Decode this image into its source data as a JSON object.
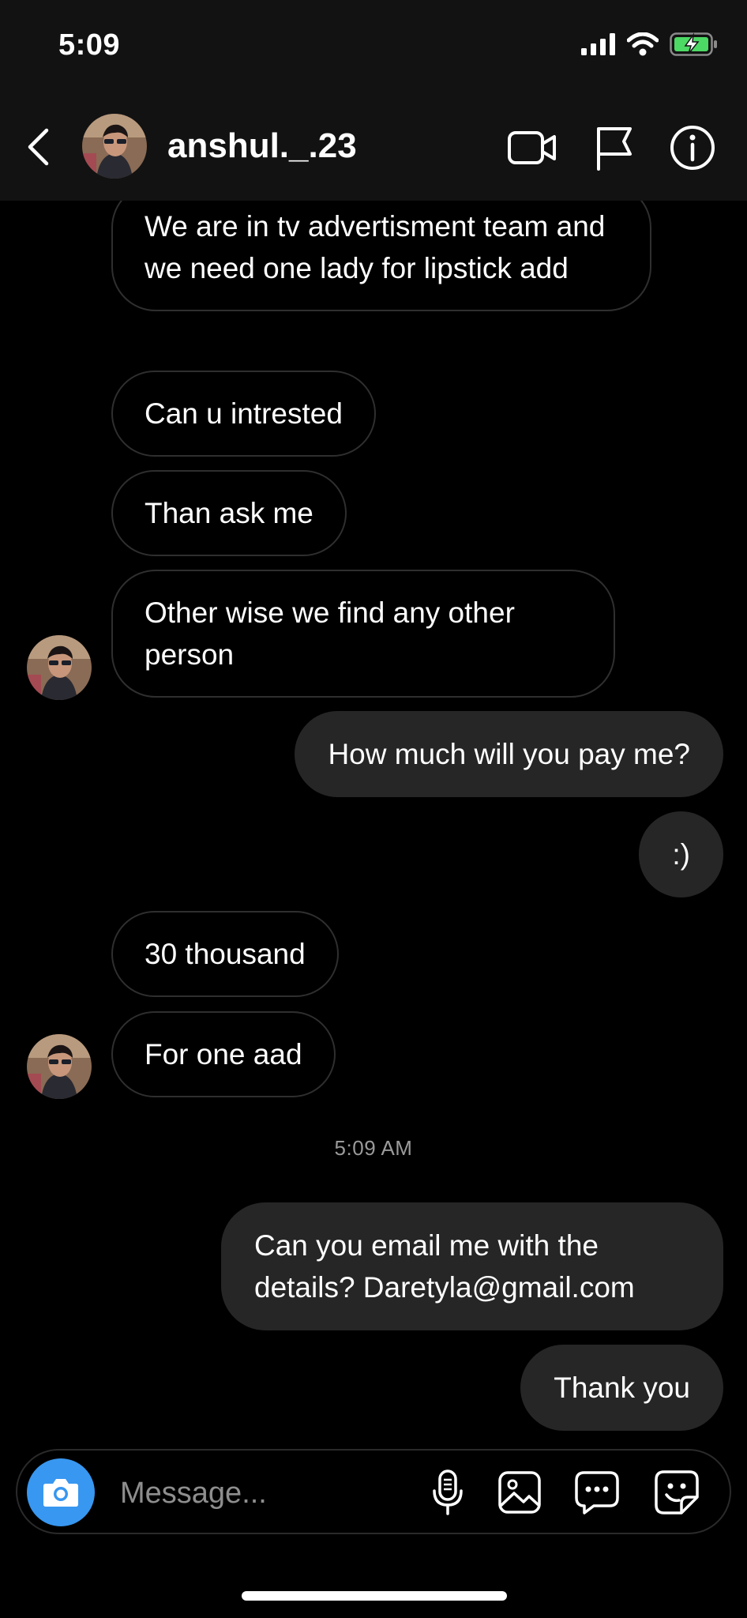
{
  "status_bar": {
    "time": "5:09"
  },
  "header": {
    "username": "anshul._.23",
    "icons": [
      "back-icon",
      "video-call-icon",
      "flag-icon",
      "info-icon"
    ]
  },
  "messages": [
    {
      "from": "them",
      "text": "We are in tv advertisment team and we need one lady for lipstick add"
    },
    {
      "from": "them",
      "text": "Can u intrested"
    },
    {
      "from": "them",
      "text": "Than ask me"
    },
    {
      "from": "them",
      "text": "Other wise we find any other person"
    },
    {
      "from": "me",
      "text": "How much will you pay me?"
    },
    {
      "from": "me",
      "text": ":)"
    },
    {
      "from": "them",
      "text": "30 thousand"
    },
    {
      "from": "them",
      "text": "For one aad"
    },
    {
      "from": "me",
      "text": "Can you email me with the details? Daretyla@gmail.com"
    },
    {
      "from": "me",
      "text": "Thank you"
    }
  ],
  "timestamp": "5:09 AM",
  "composer": {
    "placeholder": "Message...",
    "icons": [
      "camera-icon",
      "microphone-icon",
      "gallery-icon",
      "chat-bubble-icon",
      "sticker-icon"
    ]
  },
  "colors": {
    "background": "#000000",
    "header_bg": "#121212",
    "outgoing_bubble": "#262626",
    "incoming_border": "#2f2f2f",
    "camera_button": "#3897f0",
    "battery_fill": "#4cd964"
  }
}
